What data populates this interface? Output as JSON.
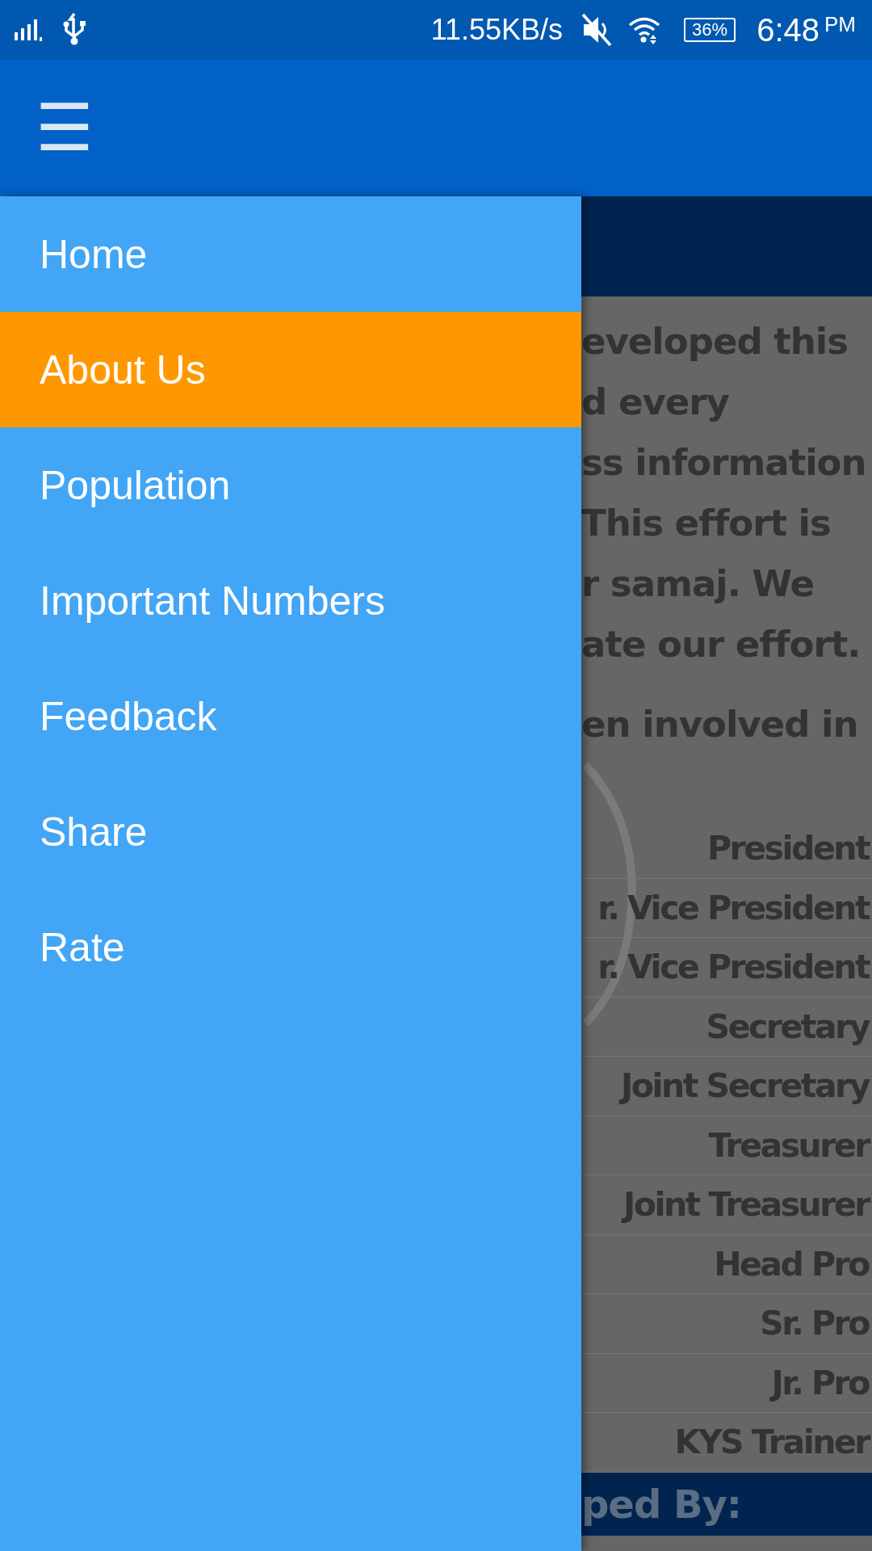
{
  "status_bar": {
    "speed": "11.55KB/s",
    "battery": "36%",
    "time": "6:48",
    "ampm": "PM"
  },
  "app_bar": {
    "menu_icon": "☰"
  },
  "background": {
    "paragraph_lines": [
      "eveloped this",
      "d every",
      "ss information",
      "This effort is",
      "r samaj. We",
      "ate our effort."
    ],
    "paragraph2_line": "en involved in",
    "roles": [
      "President",
      "r. Vice President",
      "r. Vice President",
      "Secretary",
      "Joint Secretary",
      "Treasurer",
      "Joint Treasurer",
      "Head Pro",
      "Sr. Pro",
      "Jr. Pro",
      "KYS Trainer"
    ],
    "footer_heading": "ped By:"
  },
  "drawer": {
    "items": [
      {
        "label": "Home",
        "selected": false
      },
      {
        "label": "About Us",
        "selected": true
      },
      {
        "label": "Population",
        "selected": false
      },
      {
        "label": "Important Numbers",
        "selected": false
      },
      {
        "label": "Feedback",
        "selected": false
      },
      {
        "label": "Share",
        "selected": false
      },
      {
        "label": "Rate",
        "selected": false
      }
    ]
  }
}
